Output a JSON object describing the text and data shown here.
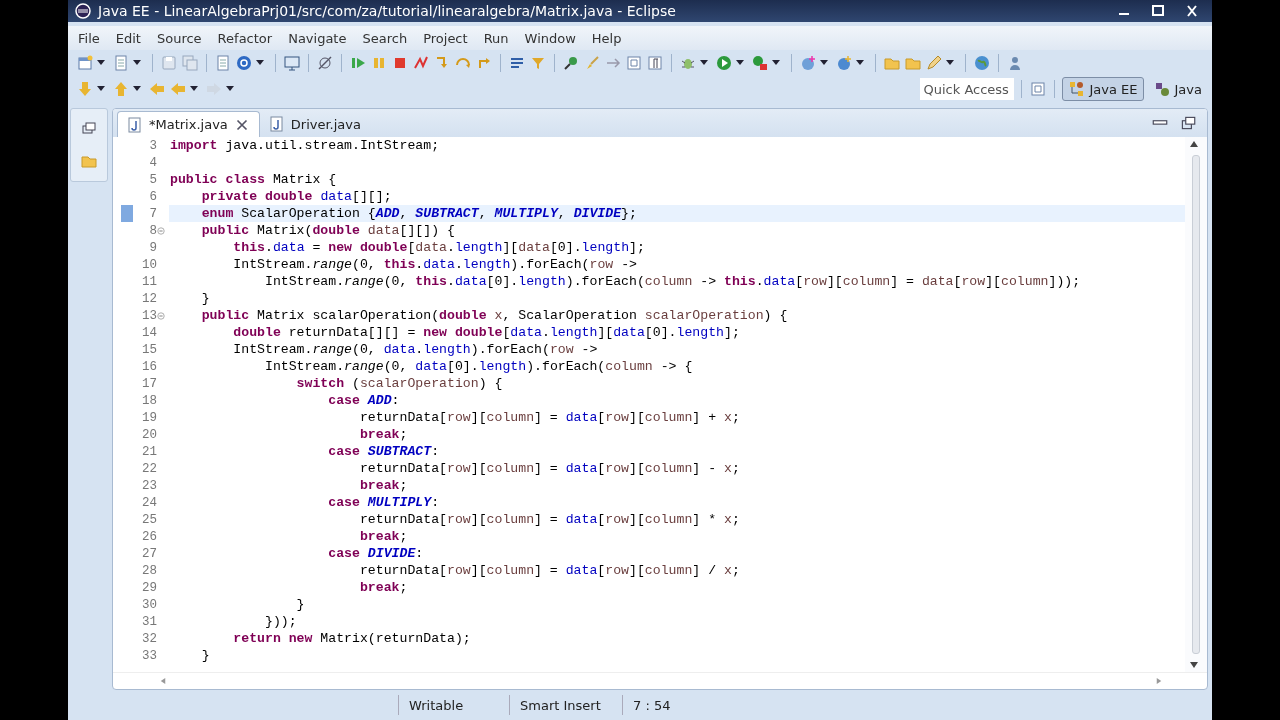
{
  "window": {
    "title": "Java EE - LinearAlgebraPrj01/src/com/za/tutorial/linearalgebra/Matrix.java - Eclipse"
  },
  "menu": [
    "File",
    "Edit",
    "Source",
    "Refactor",
    "Navigate",
    "Search",
    "Project",
    "Run",
    "Window",
    "Help"
  ],
  "quick_access": {
    "placeholder": "Quick Access"
  },
  "perspectives": [
    {
      "label": "Java EE",
      "selected": true
    },
    {
      "label": "Java",
      "selected": false
    }
  ],
  "editor_tabs": [
    {
      "label": "*Matrix.java",
      "selected": true
    },
    {
      "label": "Driver.java",
      "selected": false
    }
  ],
  "code_lines": [
    {
      "n": "3",
      "current": false,
      "foldable": false,
      "tokens": [
        {
          "kind": "kw",
          "text": "import"
        },
        {
          "kind": "p",
          "text": " java.util.stream.IntStream;"
        }
      ]
    },
    {
      "n": "4",
      "current": false,
      "foldable": false
    },
    {
      "n": "5",
      "current": false,
      "foldable": false,
      "tokens": [
        {
          "kind": "kw",
          "text": "public class"
        },
        {
          "kind": "p",
          "text": " Matrix {"
        }
      ]
    },
    {
      "n": "6",
      "current": false,
      "foldable": false,
      "tokens": [
        {
          "kind": "kw",
          "text": "    private double "
        },
        {
          "kind": "field",
          "text": "data"
        },
        {
          "kind": "p",
          "text": "[][];"
        }
      ]
    },
    {
      "n": "7",
      "current": true,
      "foldable": false,
      "tokens": [
        {
          "kind": "kw",
          "text": "    enum"
        },
        {
          "kind": "p",
          "text": " ScalarOperation {"
        },
        {
          "kind": "const",
          "text": "ADD"
        },
        {
          "kind": "p",
          "text": ", "
        },
        {
          "kind": "const",
          "text": "SUBTRACT"
        },
        {
          "kind": "p",
          "text": ", "
        },
        {
          "kind": "const",
          "text": "MULTIPLY"
        },
        {
          "kind": "p",
          "text": ", "
        },
        {
          "kind": "const",
          "text": "DIVIDE"
        },
        {
          "kind": "p",
          "text": "};"
        }
      ]
    },
    {
      "n": "8",
      "current": false,
      "foldable": true,
      "tokens": [
        {
          "kind": "kw",
          "text": "    public"
        },
        {
          "kind": "p",
          "text": " Matrix("
        },
        {
          "kind": "kw",
          "text": "double "
        },
        {
          "kind": "var",
          "text": "data"
        },
        {
          "kind": "p",
          "text": "[][]) {"
        }
      ]
    },
    {
      "n": "9",
      "current": false,
      "foldable": false,
      "tokens": [
        {
          "kind": "kw",
          "text": "        this"
        },
        {
          "kind": "p",
          "text": "."
        },
        {
          "kind": "field",
          "text": "data"
        },
        {
          "kind": "p",
          "text": " = "
        },
        {
          "kind": "kw",
          "text": "new double"
        },
        {
          "kind": "p",
          "text": "["
        },
        {
          "kind": "var",
          "text": "data"
        },
        {
          "kind": "p",
          "text": "."
        },
        {
          "kind": "field",
          "text": "length"
        },
        {
          "kind": "p",
          "text": "]["
        },
        {
          "kind": "var",
          "text": "data"
        },
        {
          "kind": "p",
          "text": "[0]."
        },
        {
          "kind": "field",
          "text": "length"
        },
        {
          "kind": "p",
          "text": "];"
        }
      ]
    },
    {
      "n": "10",
      "current": false,
      "foldable": false,
      "tokens": [
        {
          "kind": "p",
          "text": "        IntStream."
        },
        {
          "kind": "static",
          "text": "range"
        },
        {
          "kind": "p",
          "text": "(0, "
        },
        {
          "kind": "kw",
          "text": "this"
        },
        {
          "kind": "p",
          "text": "."
        },
        {
          "kind": "field",
          "text": "data"
        },
        {
          "kind": "p",
          "text": "."
        },
        {
          "kind": "field",
          "text": "length"
        },
        {
          "kind": "p",
          "text": ").forEach("
        },
        {
          "kind": "var",
          "text": "row"
        },
        {
          "kind": "p",
          "text": " ->"
        }
      ]
    },
    {
      "n": "11",
      "current": false,
      "foldable": false,
      "tokens": [
        {
          "kind": "p",
          "text": "            IntStream."
        },
        {
          "kind": "static",
          "text": "range"
        },
        {
          "kind": "p",
          "text": "(0, "
        },
        {
          "kind": "kw",
          "text": "this"
        },
        {
          "kind": "p",
          "text": "."
        },
        {
          "kind": "field",
          "text": "data"
        },
        {
          "kind": "p",
          "text": "[0]."
        },
        {
          "kind": "field",
          "text": "length"
        },
        {
          "kind": "p",
          "text": ").forEach("
        },
        {
          "kind": "var",
          "text": "column"
        },
        {
          "kind": "p",
          "text": " -> "
        },
        {
          "kind": "kw",
          "text": "this"
        },
        {
          "kind": "p",
          "text": "."
        },
        {
          "kind": "field",
          "text": "data"
        },
        {
          "kind": "p",
          "text": "["
        },
        {
          "kind": "var",
          "text": "row"
        },
        {
          "kind": "p",
          "text": "]["
        },
        {
          "kind": "var",
          "text": "column"
        },
        {
          "kind": "p",
          "text": "] = "
        },
        {
          "kind": "var",
          "text": "data"
        },
        {
          "kind": "p",
          "text": "["
        },
        {
          "kind": "var",
          "text": "row"
        },
        {
          "kind": "p",
          "text": "]["
        },
        {
          "kind": "var",
          "text": "column"
        },
        {
          "kind": "p",
          "text": "]));"
        }
      ]
    },
    {
      "n": "12",
      "current": false,
      "foldable": false,
      "tokens": [
        {
          "kind": "p",
          "text": "    }"
        }
      ]
    },
    {
      "n": "13",
      "current": false,
      "foldable": true,
      "tokens": [
        {
          "kind": "kw",
          "text": "    public"
        },
        {
          "kind": "p",
          "text": " Matrix scalarOperation("
        },
        {
          "kind": "kw",
          "text": "double "
        },
        {
          "kind": "var",
          "text": "x"
        },
        {
          "kind": "p",
          "text": ", ScalarOperation "
        },
        {
          "kind": "var",
          "text": "scalarOperation"
        },
        {
          "kind": "p",
          "text": ") {"
        }
      ]
    },
    {
      "n": "14",
      "current": false,
      "foldable": false,
      "tokens": [
        {
          "kind": "kw",
          "text": "        double"
        },
        {
          "kind": "p",
          "text": " returnData[][] = "
        },
        {
          "kind": "kw",
          "text": "new double"
        },
        {
          "kind": "p",
          "text": "["
        },
        {
          "kind": "field",
          "text": "data"
        },
        {
          "kind": "p",
          "text": "."
        },
        {
          "kind": "field",
          "text": "length"
        },
        {
          "kind": "p",
          "text": "]["
        },
        {
          "kind": "field",
          "text": "data"
        },
        {
          "kind": "p",
          "text": "[0]."
        },
        {
          "kind": "field",
          "text": "length"
        },
        {
          "kind": "p",
          "text": "];"
        }
      ]
    },
    {
      "n": "15",
      "current": false,
      "foldable": false,
      "tokens": [
        {
          "kind": "p",
          "text": "        IntStream."
        },
        {
          "kind": "static",
          "text": "range"
        },
        {
          "kind": "p",
          "text": "(0, "
        },
        {
          "kind": "field",
          "text": "data"
        },
        {
          "kind": "p",
          "text": "."
        },
        {
          "kind": "field",
          "text": "length"
        },
        {
          "kind": "p",
          "text": ").forEach("
        },
        {
          "kind": "var",
          "text": "row"
        },
        {
          "kind": "p",
          "text": " ->"
        }
      ]
    },
    {
      "n": "16",
      "current": false,
      "foldable": false,
      "tokens": [
        {
          "kind": "p",
          "text": "            IntStream."
        },
        {
          "kind": "static",
          "text": "range"
        },
        {
          "kind": "p",
          "text": "(0, "
        },
        {
          "kind": "field",
          "text": "data"
        },
        {
          "kind": "p",
          "text": "[0]."
        },
        {
          "kind": "field",
          "text": "length"
        },
        {
          "kind": "p",
          "text": ").forEach("
        },
        {
          "kind": "var",
          "text": "column"
        },
        {
          "kind": "p",
          "text": " -> {"
        }
      ]
    },
    {
      "n": "17",
      "current": false,
      "foldable": false,
      "tokens": [
        {
          "kind": "kw",
          "text": "                switch"
        },
        {
          "kind": "p",
          "text": " ("
        },
        {
          "kind": "var",
          "text": "scalarOperation"
        },
        {
          "kind": "p",
          "text": ") {"
        }
      ]
    },
    {
      "n": "18",
      "current": false,
      "foldable": false,
      "tokens": [
        {
          "kind": "kw",
          "text": "                    case "
        },
        {
          "kind": "const",
          "text": "ADD"
        },
        {
          "kind": "p",
          "text": ":"
        }
      ]
    },
    {
      "n": "19",
      "current": false,
      "foldable": false,
      "tokens": [
        {
          "kind": "p",
          "text": "                        returnData["
        },
        {
          "kind": "var",
          "text": "row"
        },
        {
          "kind": "p",
          "text": "]["
        },
        {
          "kind": "var",
          "text": "column"
        },
        {
          "kind": "p",
          "text": "] = "
        },
        {
          "kind": "field",
          "text": "data"
        },
        {
          "kind": "p",
          "text": "["
        },
        {
          "kind": "var",
          "text": "row"
        },
        {
          "kind": "p",
          "text": "]["
        },
        {
          "kind": "var",
          "text": "column"
        },
        {
          "kind": "p",
          "text": "] + "
        },
        {
          "kind": "var",
          "text": "x"
        },
        {
          "kind": "p",
          "text": ";"
        }
      ]
    },
    {
      "n": "20",
      "current": false,
      "foldable": false,
      "tokens": [
        {
          "kind": "kw",
          "text": "                        break"
        },
        {
          "kind": "p",
          "text": ";"
        }
      ]
    },
    {
      "n": "21",
      "current": false,
      "foldable": false,
      "tokens": [
        {
          "kind": "kw",
          "text": "                    case "
        },
        {
          "kind": "const",
          "text": "SUBTRACT"
        },
        {
          "kind": "p",
          "text": ":"
        }
      ]
    },
    {
      "n": "22",
      "current": false,
      "foldable": false,
      "tokens": [
        {
          "kind": "p",
          "text": "                        returnData["
        },
        {
          "kind": "var",
          "text": "row"
        },
        {
          "kind": "p",
          "text": "]["
        },
        {
          "kind": "var",
          "text": "column"
        },
        {
          "kind": "p",
          "text": "] = "
        },
        {
          "kind": "field",
          "text": "data"
        },
        {
          "kind": "p",
          "text": "["
        },
        {
          "kind": "var",
          "text": "row"
        },
        {
          "kind": "p",
          "text": "]["
        },
        {
          "kind": "var",
          "text": "column"
        },
        {
          "kind": "p",
          "text": "] - "
        },
        {
          "kind": "var",
          "text": "x"
        },
        {
          "kind": "p",
          "text": ";"
        }
      ]
    },
    {
      "n": "23",
      "current": false,
      "foldable": false,
      "tokens": [
        {
          "kind": "kw",
          "text": "                        break"
        },
        {
          "kind": "p",
          "text": ";"
        }
      ]
    },
    {
      "n": "24",
      "current": false,
      "foldable": false,
      "tokens": [
        {
          "kind": "kw",
          "text": "                    case "
        },
        {
          "kind": "const",
          "text": "MULTIPLY"
        },
        {
          "kind": "p",
          "text": ":"
        }
      ]
    },
    {
      "n": "25",
      "current": false,
      "foldable": false,
      "tokens": [
        {
          "kind": "p",
          "text": "                        returnData["
        },
        {
          "kind": "var",
          "text": "row"
        },
        {
          "kind": "p",
          "text": "]["
        },
        {
          "kind": "var",
          "text": "column"
        },
        {
          "kind": "p",
          "text": "] = "
        },
        {
          "kind": "field",
          "text": "data"
        },
        {
          "kind": "p",
          "text": "["
        },
        {
          "kind": "var",
          "text": "row"
        },
        {
          "kind": "p",
          "text": "]["
        },
        {
          "kind": "var",
          "text": "column"
        },
        {
          "kind": "p",
          "text": "] * "
        },
        {
          "kind": "var",
          "text": "x"
        },
        {
          "kind": "p",
          "text": ";"
        }
      ]
    },
    {
      "n": "26",
      "current": false,
      "foldable": false,
      "tokens": [
        {
          "kind": "kw",
          "text": "                        break"
        },
        {
          "kind": "p",
          "text": ";"
        }
      ]
    },
    {
      "n": "27",
      "current": false,
      "foldable": false,
      "tokens": [
        {
          "kind": "kw",
          "text": "                    case "
        },
        {
          "kind": "const",
          "text": "DIVIDE"
        },
        {
          "kind": "p",
          "text": ":"
        }
      ]
    },
    {
      "n": "28",
      "current": false,
      "foldable": false,
      "tokens": [
        {
          "kind": "p",
          "text": "                        returnData["
        },
        {
          "kind": "var",
          "text": "row"
        },
        {
          "kind": "p",
          "text": "]["
        },
        {
          "kind": "var",
          "text": "column"
        },
        {
          "kind": "p",
          "text": "] = "
        },
        {
          "kind": "field",
          "text": "data"
        },
        {
          "kind": "p",
          "text": "["
        },
        {
          "kind": "var",
          "text": "row"
        },
        {
          "kind": "p",
          "text": "]["
        },
        {
          "kind": "var",
          "text": "column"
        },
        {
          "kind": "p",
          "text": "] / "
        },
        {
          "kind": "var",
          "text": "x"
        },
        {
          "kind": "p",
          "text": ";"
        }
      ]
    },
    {
      "n": "29",
      "current": false,
      "foldable": false,
      "tokens": [
        {
          "kind": "kw",
          "text": "                        break"
        },
        {
          "kind": "p",
          "text": ";"
        }
      ]
    },
    {
      "n": "30",
      "current": false,
      "foldable": false,
      "tokens": [
        {
          "kind": "p",
          "text": "                }"
        }
      ]
    },
    {
      "n": "31",
      "current": false,
      "foldable": false,
      "tokens": [
        {
          "kind": "p",
          "text": "            }));"
        }
      ]
    },
    {
      "n": "32",
      "current": false,
      "foldable": false,
      "tokens": [
        {
          "kind": "kw",
          "text": "        return new"
        },
        {
          "kind": "p",
          "text": " Matrix(returnData);"
        }
      ]
    },
    {
      "n": "33",
      "current": false,
      "foldable": false,
      "tokens": [
        {
          "kind": "p",
          "text": "    }"
        }
      ]
    }
  ],
  "status_bar": {
    "mode": "Writable",
    "insert_mode": "Smart Insert",
    "position": "7 : 54"
  }
}
